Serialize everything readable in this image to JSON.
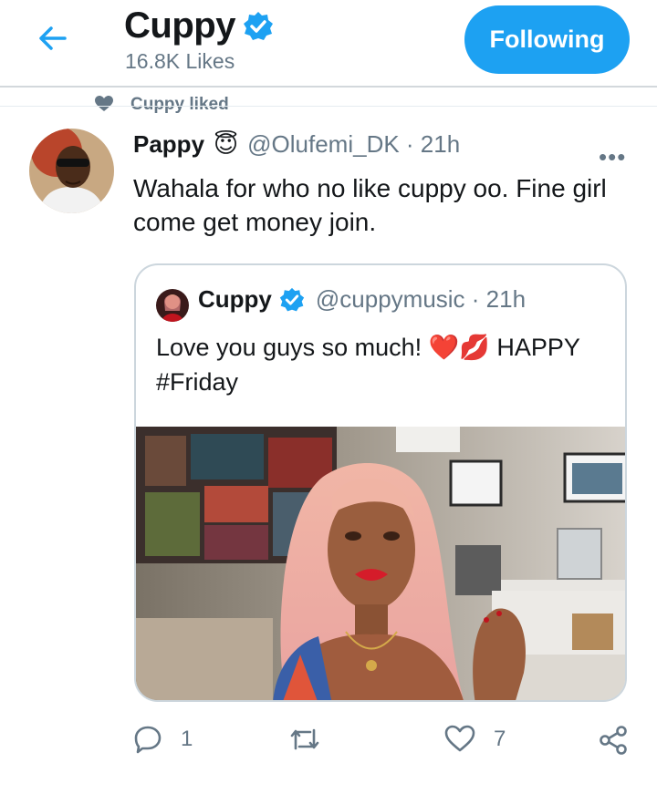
{
  "header": {
    "title": "Cuppy",
    "likes_count": "16.8K Likes",
    "follow_label": "Following"
  },
  "context": {
    "liked_by": "Cuppy liked"
  },
  "tweet": {
    "name": "Pappy",
    "name_emoji": "😇",
    "handle": "@Olufemi_DK · 21h",
    "more": "•••",
    "text": "Wahala for who no like cuppy oo. Fine girl come get money join."
  },
  "quoted": {
    "name": "Cuppy",
    "handle": "@cuppymusic · 21h",
    "text_line1": "Love you guys so much! ❤️💋 HAPPY",
    "text_line2": "#Friday"
  },
  "actions": {
    "reply_count": "1",
    "like_count": "7"
  },
  "colors": {
    "accent": "#1da1f2",
    "secondary_text": "#657786",
    "border": "#ccd6dd"
  }
}
